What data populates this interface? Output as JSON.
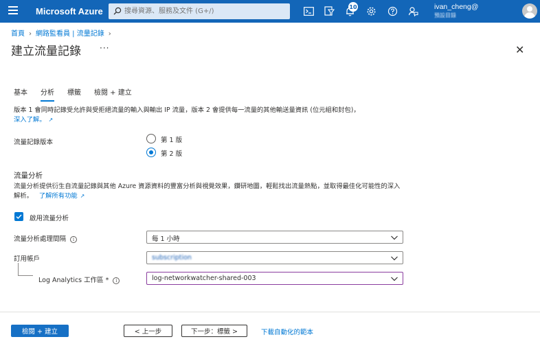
{
  "header": {
    "brand": "Microsoft Azure",
    "search_placeholder": "搜尋資源、服務及文件 (G+/)",
    "notification_count": "10",
    "user_name": "ivan_cheng@",
    "user_directory": "預設目錄"
  },
  "breadcrumb": {
    "home": "首頁",
    "parent": "網路監看員 | 流量記錄"
  },
  "page": {
    "title": "建立流量記錄",
    "more": "···"
  },
  "tabs": [
    {
      "label": "基本",
      "active": false
    },
    {
      "label": "分析",
      "active": true
    },
    {
      "label": "標籤",
      "active": false
    },
    {
      "label": "檢閱 + 建立",
      "active": false
    }
  ],
  "description": {
    "text": "版本 1 會同時記錄受允許與受拒絕流量的輸入與輸出 IP 流量，版本 2 會提供每一流量的其他輸送量資訊 (位元組和封包)，",
    "learn_more": "深入了解。"
  },
  "flow_log_version": {
    "label": "流量記錄版本",
    "options": [
      "第 1 版",
      "第 2 版"
    ],
    "selected": "第 2 版"
  },
  "traffic_analytics": {
    "title": "流量分析",
    "description": "流量分析提供衍生自流量記錄與其他 Azure 資源資料的豐富分析與視覺效果，鑽研地圖，輕鬆找出流量熱點，並取得最佳化可能性的深入解析。",
    "learn_more": "了解所有功能",
    "enable_label": "啟用流量分析",
    "enabled": true
  },
  "form": {
    "interval_label": "流量分析處理間隔",
    "interval_value": "每 1 小時",
    "subscription_label": "訂用帳戶",
    "subscription_value": "subscription",
    "workspace_label": "Log Analytics 工作區 *",
    "workspace_value": "log-networkwatcher-shared-003"
  },
  "footer": {
    "review_create": "檢閱 + 建立",
    "previous": "< 上一步",
    "next": "下一步：標籤 >",
    "download_template": "下載自動化的範本"
  },
  "colors": {
    "topbar": "#1366b8",
    "accent": "#0078d4",
    "primary_button": "#1670c5"
  }
}
